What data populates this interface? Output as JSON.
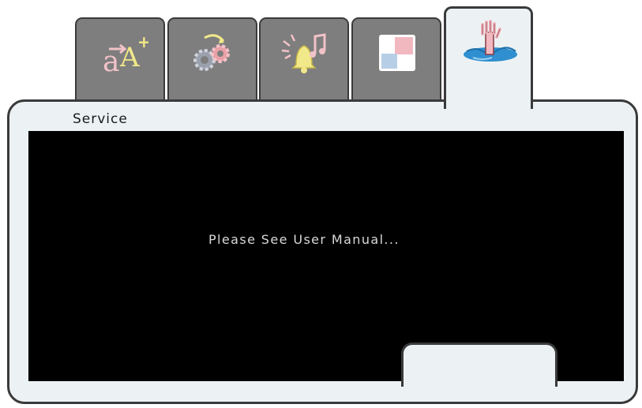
{
  "tabs": [
    {
      "name": "text-size",
      "icon": "text-size-icon"
    },
    {
      "name": "settings",
      "icon": "gears-icon"
    },
    {
      "name": "alerts-sound",
      "icon": "bell-music-icon"
    },
    {
      "name": "display",
      "icon": "color-squares-icon"
    },
    {
      "name": "service",
      "icon": "hand-in-water-icon",
      "active": true
    }
  ],
  "panel": {
    "title": "Service",
    "message": "Please See User Manual..."
  },
  "colors": {
    "tab_inactive": "#7e7e7e",
    "panel_bg": "#ecf2f4",
    "screen_bg": "#000000",
    "border": "#3a3a3a"
  }
}
